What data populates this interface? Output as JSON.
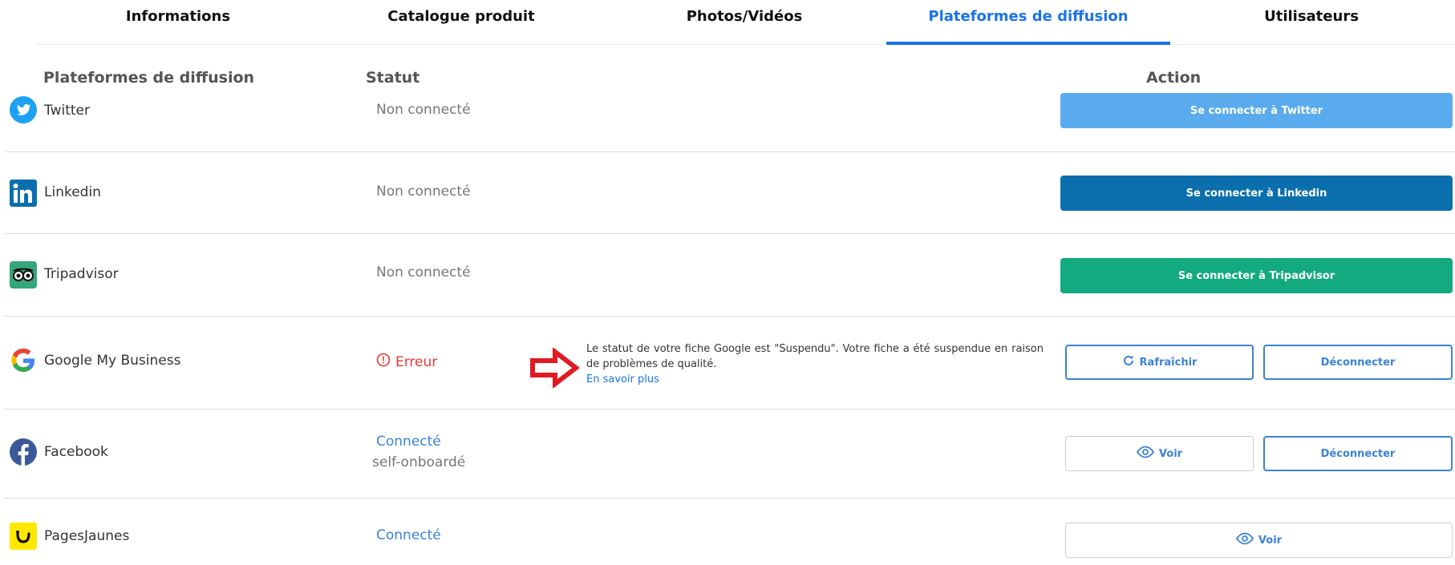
{
  "tabs": [
    "Informations",
    "Catalogue produit",
    "Photos/Vidéos",
    "Plateformes de diffusion",
    "Utilisateurs"
  ],
  "headers": {
    "platforms": "Plateformes de diffusion",
    "status": "Statut",
    "action": "Action"
  },
  "rows": {
    "twitter": {
      "name": "Twitter",
      "status": "Non connecté",
      "action": "Se connecter à Twitter"
    },
    "linkedin": {
      "name": "Linkedin",
      "status": "Non connecté",
      "action": "Se connecter à Linkedin"
    },
    "tripadvisor": {
      "name": "Tripadvisor",
      "status": "Non connecté",
      "action": "Se connecter à Tripadvisor"
    },
    "google": {
      "name": "Google My Business",
      "status": "Erreur",
      "message": "Le statut de votre fiche Google est \"Suspendu\". Votre fiche a été suspendue en raison de problèmes de qualité.",
      "link": "En savoir plus",
      "refresh": "Rafraîchir",
      "disconnect": "Déconnecter"
    },
    "facebook": {
      "name": "Facebook",
      "status": "Connecté",
      "status_sub": "self-onboardé",
      "view": "Voir",
      "disconnect": "Déconnecter"
    },
    "pagesjaunes": {
      "name": "PagesJaunes",
      "status": "Connecté",
      "view": "Voir"
    }
  },
  "colors": {
    "twitter": "#5aabed",
    "linkedin": "#0b6fad",
    "tripadvisor": "#12aa7e",
    "accent": "#1a73e8",
    "error": "#e53935",
    "arrow": "#e01b22",
    "pagesjaunes": "#ffe800"
  }
}
